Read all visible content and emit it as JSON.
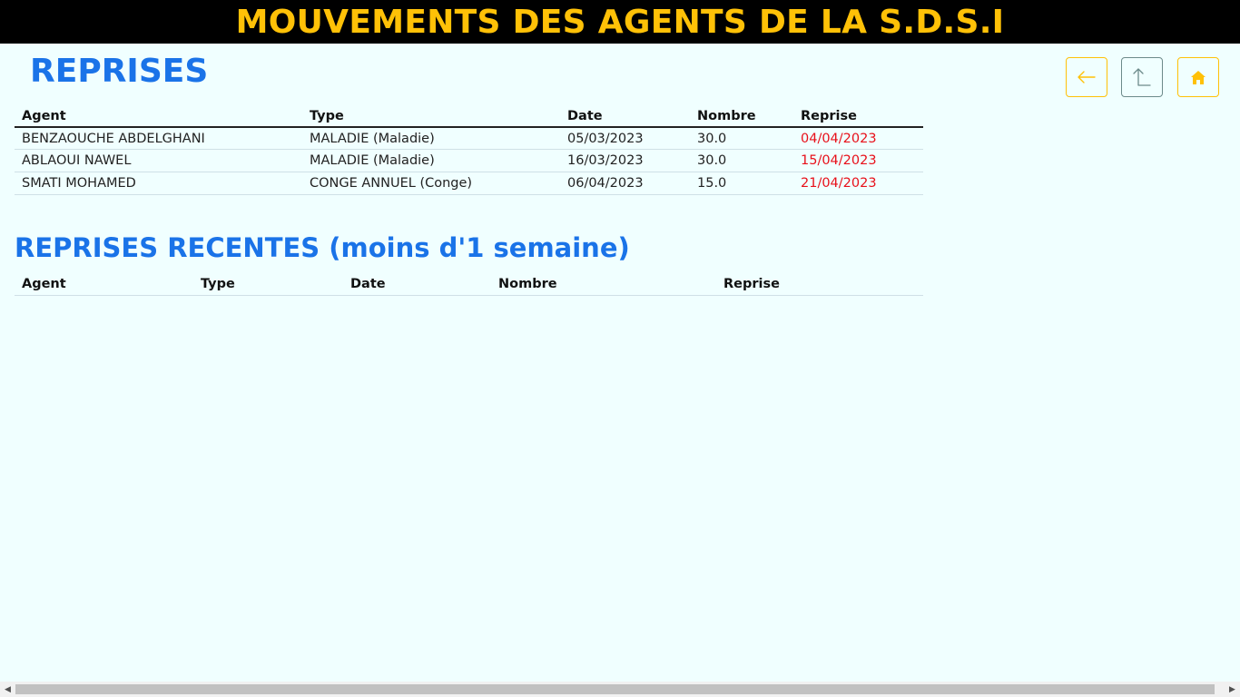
{
  "header": {
    "title": "MOUVEMENTS DES AGENTS DE LA S.D.S.I"
  },
  "page": {
    "title": "REPRISES"
  },
  "toolbar": {
    "back_icon": "arrow-left-icon",
    "up_icon": "arrow-up-turn-icon",
    "home_icon": "home-icon",
    "accent_color": "#ffc107"
  },
  "reprises_table": {
    "columns": [
      "Agent",
      "Type",
      "Date",
      "Nombre",
      "Reprise"
    ],
    "rows": [
      [
        "BENZAOUCHE ABDELGHANI",
        "MALADIE (Maladie)",
        "05/03/2023",
        "30.0",
        "04/04/2023"
      ],
      [
        "ABLAOUI NAWEL",
        "MALADIE (Maladie)",
        "16/03/2023",
        "30.0",
        "15/04/2023"
      ],
      [
        "SMATI MOHAMED",
        "CONGE ANNUEL (Conge)",
        "06/04/2023",
        "15.0",
        "21/04/2023"
      ]
    ]
  },
  "recent_section": {
    "title": "REPRISES RECENTES (moins d'1 semaine)"
  },
  "recent_table": {
    "columns": [
      "Agent",
      "Type",
      "Date",
      "Nombre",
      "Reprise"
    ],
    "rows": []
  },
  "colors": {
    "title_blue": "#1a73e8",
    "reprise_red": "#e8101a",
    "header_bg": "#000000",
    "page_bg": "#f0ffff"
  }
}
